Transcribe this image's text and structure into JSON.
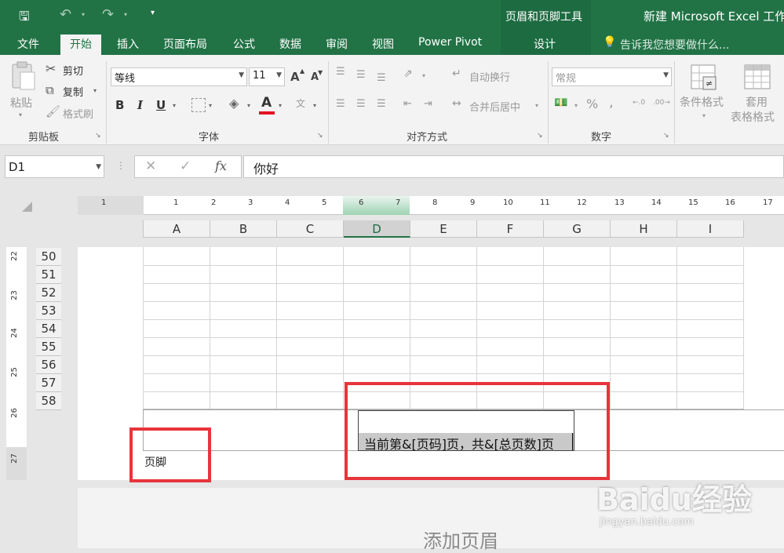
{
  "window": {
    "title": "新建 Microsoft Excel 工作",
    "contextual_group": "页眉和页脚工具"
  },
  "qat": {
    "save_icon": "save-icon",
    "undo_icon": "undo-icon",
    "redo_icon": "redo-icon"
  },
  "tabs": [
    {
      "label": "文件"
    },
    {
      "label": "开始"
    },
    {
      "label": "插入"
    },
    {
      "label": "页面布局"
    },
    {
      "label": "公式"
    },
    {
      "label": "数据"
    },
    {
      "label": "审阅"
    },
    {
      "label": "视图"
    },
    {
      "label": "Power Pivot"
    },
    {
      "label": "设计"
    }
  ],
  "tell_me": "告诉我您想要做什么...",
  "ribbon": {
    "clipboard": {
      "paste": "粘贴",
      "cut": "剪切",
      "copy": "复制",
      "format_painter": "格式刷",
      "group": "剪贴板"
    },
    "font": {
      "name": "等线",
      "size": "11",
      "group": "字体",
      "bold": "B",
      "italic": "I",
      "underline": "U",
      "grow": "A",
      "shrink": "A",
      "color_letter": "A",
      "font_color": "#e81123"
    },
    "alignment": {
      "wrap": "自动换行",
      "merge": "合并后居中",
      "group": "对齐方式"
    },
    "number": {
      "format": "常规",
      "percent": "%",
      "comma": ",",
      "group": "数字"
    },
    "styles": {
      "cond_format": "条件格式",
      "table_format_1": "套用",
      "table_format_2": "表格格式"
    }
  },
  "formula_bar": {
    "name_box": "D1",
    "content": "你好"
  },
  "ruler": [
    "1",
    "1",
    "2",
    "3",
    "4",
    "5",
    "6",
    "7",
    "8",
    "9",
    "10",
    "11",
    "12",
    "13",
    "14",
    "15",
    "16",
    "17"
  ],
  "vruler": [
    "22",
    "23",
    "24",
    "25",
    "26",
    "27"
  ],
  "columns": [
    "A",
    "B",
    "C",
    "D",
    "E",
    "F",
    "G",
    "H",
    "I"
  ],
  "selected_column": "D",
  "rows": [
    "50",
    "51",
    "52",
    "53",
    "54",
    "55",
    "56",
    "57",
    "58"
  ],
  "footer": {
    "label": "页脚",
    "center_text": "当前第&[页码]页，共&[总页数]页"
  },
  "next_page": {
    "add_header": "添加页眉"
  },
  "watermark": {
    "brand": "Baidu经验",
    "url": "jingyan.baidu.com"
  }
}
